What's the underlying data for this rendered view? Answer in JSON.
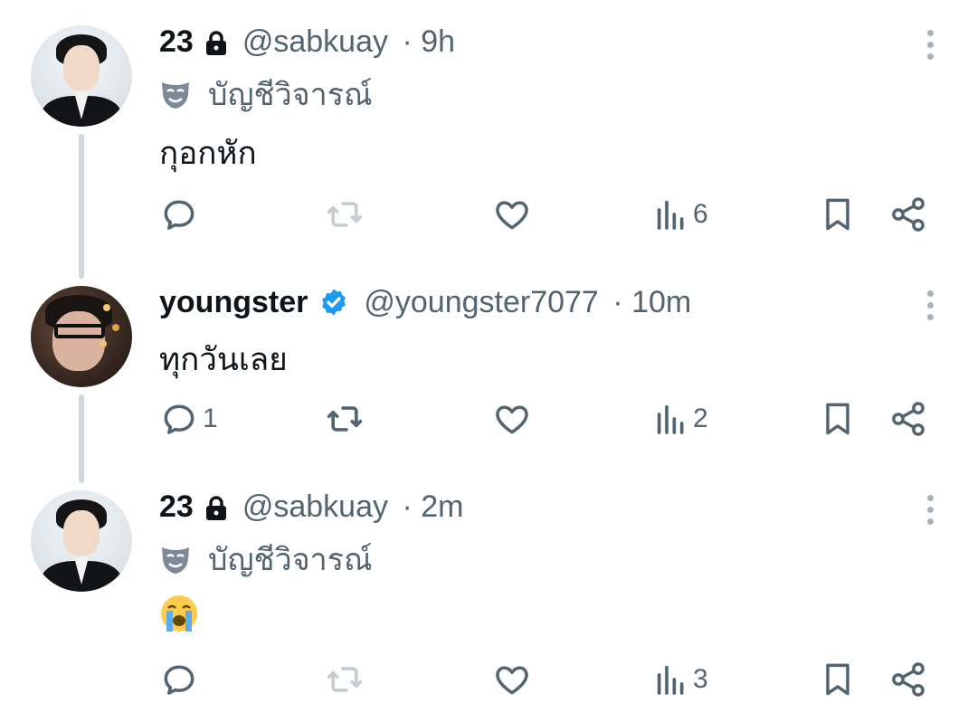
{
  "tweets": [
    {
      "name": "23",
      "locked": true,
      "verified": false,
      "handle": "@sabkuay",
      "time": "9h",
      "label": "บัญชีวิจารณ์",
      "text": "กุอกหัก",
      "metrics": {
        "replies": "",
        "views": "6"
      }
    },
    {
      "name": "youngster",
      "locked": false,
      "verified": true,
      "handle": "@youngster7077",
      "time": "10m",
      "label": "",
      "text": "ทุกวันเลย",
      "metrics": {
        "replies": "1",
        "views": "2"
      }
    },
    {
      "name": "23",
      "locked": true,
      "verified": false,
      "handle": "@sabkuay",
      "time": "2m",
      "label": "บัญชีวิจารณ์",
      "text": "😭",
      "metrics": {
        "replies": "",
        "views": "3"
      }
    }
  ],
  "separator": "·",
  "colors": {
    "text": "#0f1419",
    "secondary": "#536471",
    "verified": "#1d9bf0",
    "thread_line": "#cfd9de"
  },
  "icons": [
    "reply-icon",
    "retweet-icon",
    "like-icon",
    "views-icon",
    "bookmark-icon",
    "share-icon",
    "lock-icon",
    "verified-icon",
    "mask-icon",
    "more-icon"
  ]
}
